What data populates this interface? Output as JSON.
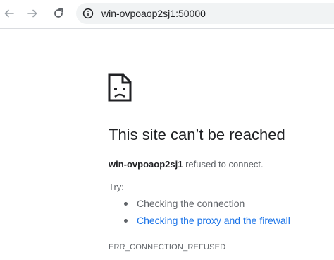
{
  "browser": {
    "back_icon": "arrow-left-icon",
    "forward_icon": "arrow-right-icon",
    "reload_icon": "reload-icon",
    "site_info_icon": "info-circle-icon",
    "url": "win-ovpoaop2sj1:50000"
  },
  "error_page": {
    "icon": "sad-document-icon",
    "title": "This site can’t be reached",
    "host": "win-ovpoaop2sj1",
    "message": " refused to connect.",
    "try_label": "Try:",
    "suggestions": [
      {
        "text": "Checking the connection",
        "is_link": false
      },
      {
        "text": "Checking the proxy and the firewall",
        "is_link": true
      }
    ],
    "error_code": "ERR_CONNECTION_REFUSED"
  },
  "colors": {
    "text": "#202124",
    "secondary_text": "#5f6368",
    "link": "#1a73e8",
    "omnibox_bg": "#f1f3f4"
  }
}
